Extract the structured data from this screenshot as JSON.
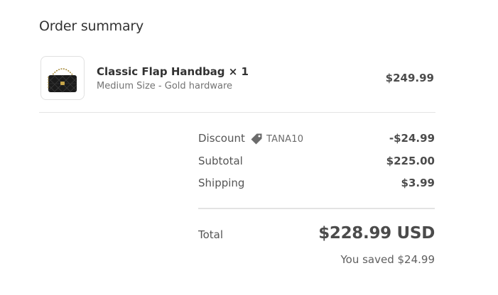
{
  "summary": {
    "title": "Order summary"
  },
  "line_item": {
    "name": "Classic Flap Handbag × 1",
    "variant": "Medium Size - Gold hardware",
    "price": "$249.99",
    "image_icon": "handbag-image"
  },
  "discount": {
    "label": "Discount",
    "code": "TANA10",
    "icon": "tag-icon",
    "value": "-$24.99"
  },
  "subtotal": {
    "label": "Subtotal",
    "value": "$225.00"
  },
  "shipping": {
    "label": "Shipping",
    "value": "$3.99"
  },
  "total": {
    "label": "Total",
    "value": "$228.99 USD",
    "saved": "You saved $24.99"
  },
  "colors": {
    "text_primary": "#323232",
    "text_secondary": "#737373",
    "divider": "#e3e3e3",
    "tag_icon": "#6b6b6b"
  }
}
